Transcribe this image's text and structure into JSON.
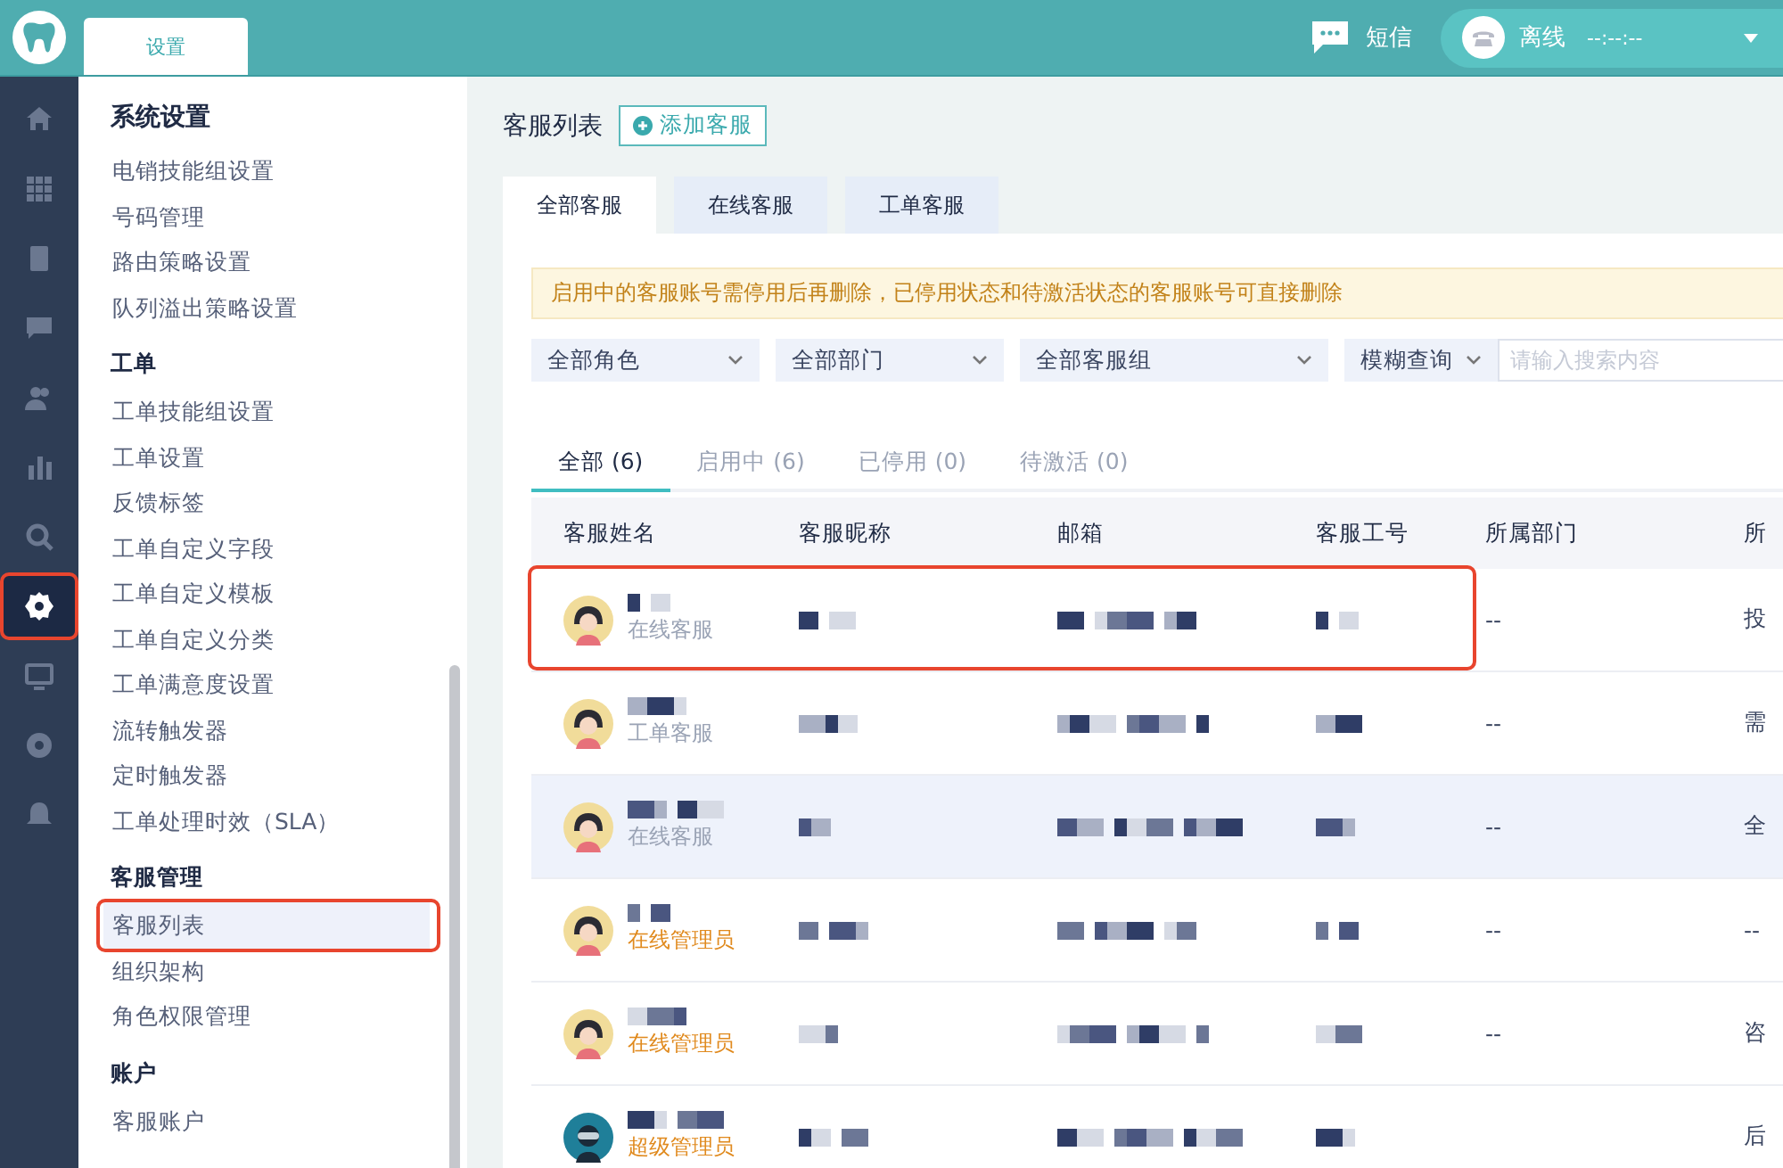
{
  "topbar": {
    "tab": "设置",
    "sms": "短信",
    "status": "离线",
    "timer": "--:--:--"
  },
  "rail": [
    {
      "selected": false,
      "highlighted": false
    },
    {
      "selected": false,
      "highlighted": false
    },
    {
      "selected": false,
      "highlighted": false
    },
    {
      "selected": false,
      "highlighted": false
    },
    {
      "selected": false,
      "highlighted": false
    },
    {
      "selected": false,
      "highlighted": false
    },
    {
      "selected": false,
      "highlighted": false
    },
    {
      "selected": true,
      "highlighted": true
    },
    {
      "selected": false,
      "highlighted": false
    },
    {
      "selected": false,
      "highlighted": false
    },
    {
      "selected": false,
      "highlighted": false
    }
  ],
  "sidebar": {
    "title": "系统设置",
    "sections": [
      {
        "items": [
          {
            "label": "电销技能组设置",
            "selected": false,
            "highlighted": false
          },
          {
            "label": "号码管理",
            "selected": false,
            "highlighted": false
          },
          {
            "label": "路由策略设置",
            "selected": false,
            "highlighted": false
          },
          {
            "label": "队列溢出策略设置",
            "selected": false,
            "highlighted": false
          }
        ]
      },
      {
        "heading": "工单",
        "items": [
          {
            "label": "工单技能组设置",
            "selected": false,
            "highlighted": false
          },
          {
            "label": "工单设置",
            "selected": false,
            "highlighted": false
          },
          {
            "label": "反馈标签",
            "selected": false,
            "highlighted": false
          },
          {
            "label": "工单自定义字段",
            "selected": false,
            "highlighted": false
          },
          {
            "label": "工单自定义模板",
            "selected": false,
            "highlighted": false
          },
          {
            "label": "工单自定义分类",
            "selected": false,
            "highlighted": false
          },
          {
            "label": "工单满意度设置",
            "selected": false,
            "highlighted": false
          },
          {
            "label": "流转触发器",
            "selected": false,
            "highlighted": false
          },
          {
            "label": "定时触发器",
            "selected": false,
            "highlighted": false
          },
          {
            "label": "工单处理时效（SLA）",
            "selected": false,
            "highlighted": false
          }
        ]
      },
      {
        "heading": "客服管理",
        "items": [
          {
            "label": "客服列表",
            "selected": true,
            "highlighted": true
          },
          {
            "label": "组织架构",
            "selected": false,
            "highlighted": false
          },
          {
            "label": "角色权限管理",
            "selected": false,
            "highlighted": false
          }
        ]
      },
      {
        "heading": "账户",
        "items": [
          {
            "label": "客服账户",
            "selected": false,
            "highlighted": false
          }
        ]
      }
    ]
  },
  "page": {
    "title": "客服列表",
    "add_button": "添加客服"
  },
  "tabs": [
    {
      "label": "全部客服",
      "selected": true
    },
    {
      "label": "在线客服",
      "selected": false
    },
    {
      "label": "工单客服",
      "selected": false
    }
  ],
  "notice": "启用中的客服账号需停用后再删除，已停用状态和待激活状态的客服账号可直接删除",
  "filters": [
    {
      "label": "全部角色"
    },
    {
      "label": "全部部门"
    },
    {
      "label": "全部客服组"
    }
  ],
  "search": {
    "mode": "模糊查询",
    "placeholder": "请输入搜索内容"
  },
  "status_tabs": [
    {
      "label": "全部 (6)",
      "selected": true
    },
    {
      "label": "启用中 (6)",
      "selected": false
    },
    {
      "label": "已停用 (0)",
      "selected": false
    },
    {
      "label": "待激活 (0)",
      "selected": false
    }
  ],
  "table": {
    "columns": [
      "客服姓名",
      "客服昵称",
      "邮箱",
      "客服工号",
      "所属部门",
      "所"
    ],
    "rows": [
      {
        "kind": "agent",
        "role": "在线客服",
        "dept": "--",
        "column_6": "投",
        "highlighted": true,
        "hovered": false
      },
      {
        "kind": "agent",
        "role": "工单客服",
        "dept": "--",
        "column_6": "需",
        "highlighted": false,
        "hovered": false
      },
      {
        "kind": "agent",
        "role": "在线客服",
        "dept": "--",
        "column_6": "全",
        "highlighted": false,
        "hovered": true
      },
      {
        "kind": "admin",
        "role": "在线管理员",
        "dept": "--",
        "column_6": "--",
        "highlighted": false,
        "hovered": false
      },
      {
        "kind": "admin",
        "role": "在线管理员",
        "dept": "--",
        "column_6": "咨",
        "highlighted": false,
        "hovered": false
      },
      {
        "kind": "superadmin",
        "role": "超级管理员",
        "column_6": "后",
        "highlighted": false,
        "hovered": false
      }
    ]
  }
}
